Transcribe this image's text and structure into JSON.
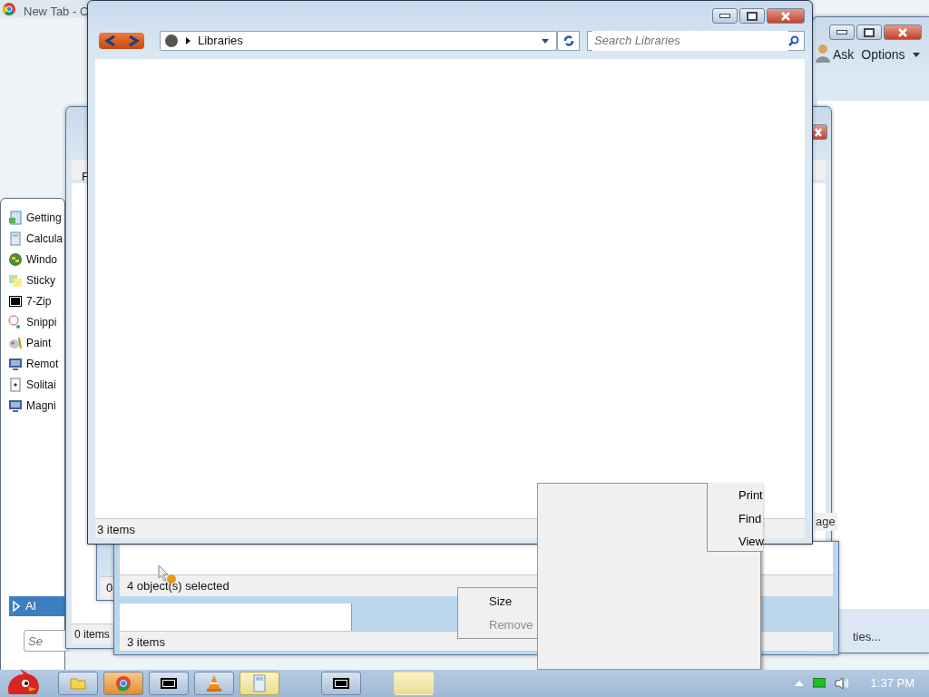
{
  "browser_window": {
    "title": "New Tab - C"
  },
  "start_menu": {
    "items": [
      {
        "label": "Getting"
      },
      {
        "label": "Calcula"
      },
      {
        "label": "Windo"
      },
      {
        "label": "Sticky"
      },
      {
        "label": "7-Zip"
      },
      {
        "label": "Snippi"
      },
      {
        "label": "Paint"
      },
      {
        "label": "Remot"
      },
      {
        "label": "Solitai"
      },
      {
        "label": "Magni"
      }
    ],
    "all_programs": "Al",
    "search_placeholder": "Se"
  },
  "help_window": {
    "links": [
      {
        "label": "Ask"
      },
      {
        "label": "Options"
      }
    ]
  },
  "back_explorer": {
    "menu_letter": "F",
    "status": "0 items"
  },
  "middle_explorer": {
    "status": "0"
  },
  "lower_explorer": {
    "selection_status": "4 object(s) selected",
    "status": "3 items"
  },
  "main_window": {
    "address": "Libraries",
    "search_placeholder": "Search Libraries",
    "status": "3 items"
  },
  "context_menu": [
    {
      "label": "Size",
      "disabled": false
    },
    {
      "label": "Remove",
      "disabled": true
    }
  ],
  "submenu": [
    {
      "label": "Print"
    },
    {
      "label": "Find"
    },
    {
      "label": "View"
    }
  ],
  "stray_texts": [
    "age",
    "ties..."
  ],
  "taskbar": {
    "buttons": [
      {
        "kind": "folder",
        "flashing": false,
        "highlighted": false
      },
      {
        "kind": "chrome",
        "flashing": true,
        "highlighted": false
      },
      {
        "kind": "zip",
        "flashing": false,
        "highlighted": false
      },
      {
        "kind": "cone",
        "flashing": false,
        "highlighted": false
      },
      {
        "kind": "calc",
        "flashing": false,
        "highlighted": true
      },
      {
        "kind": "zip",
        "flashing": false,
        "highlighted": false
      },
      {
        "kind": "blank",
        "flashing": false,
        "highlighted": true
      }
    ],
    "clock": "1:37 PM"
  }
}
